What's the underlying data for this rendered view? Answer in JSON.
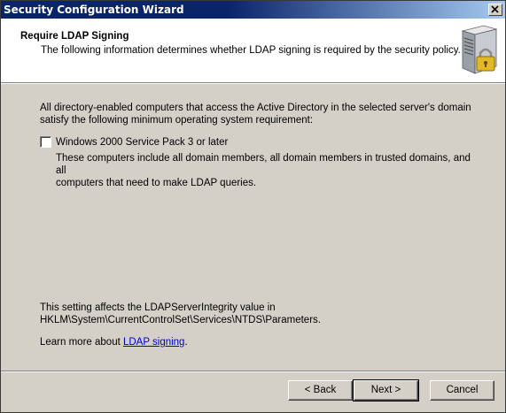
{
  "window": {
    "title": "Security Configuration Wizard"
  },
  "header": {
    "title": "Require LDAP Signing",
    "description": "The following information determines whether LDAP signing is required by the security policy.",
    "icon": "server-lock-icon"
  },
  "content": {
    "intro_line1": "All directory-enabled computers that access the Active Directory in the selected server's domain",
    "intro_line2": "satisfy the following minimum operating system requirement:",
    "checkbox": {
      "label": "Windows 2000 Service Pack 3 or later",
      "checked": false,
      "description_line1": "These computers include all domain members, all domain members in trusted domains, and all",
      "description_line2": "computers that need to make LDAP queries."
    },
    "setting_line1": "This setting affects the LDAPServerIntegrity value in",
    "setting_line2": "HKLM\\System\\CurrentControlSet\\Services\\NTDS\\Parameters.",
    "learn_more_prefix": "Learn more about ",
    "learn_more_link": "LDAP signing",
    "learn_more_suffix": "."
  },
  "buttons": {
    "back": "< Back",
    "next": "Next >",
    "cancel": "Cancel"
  }
}
